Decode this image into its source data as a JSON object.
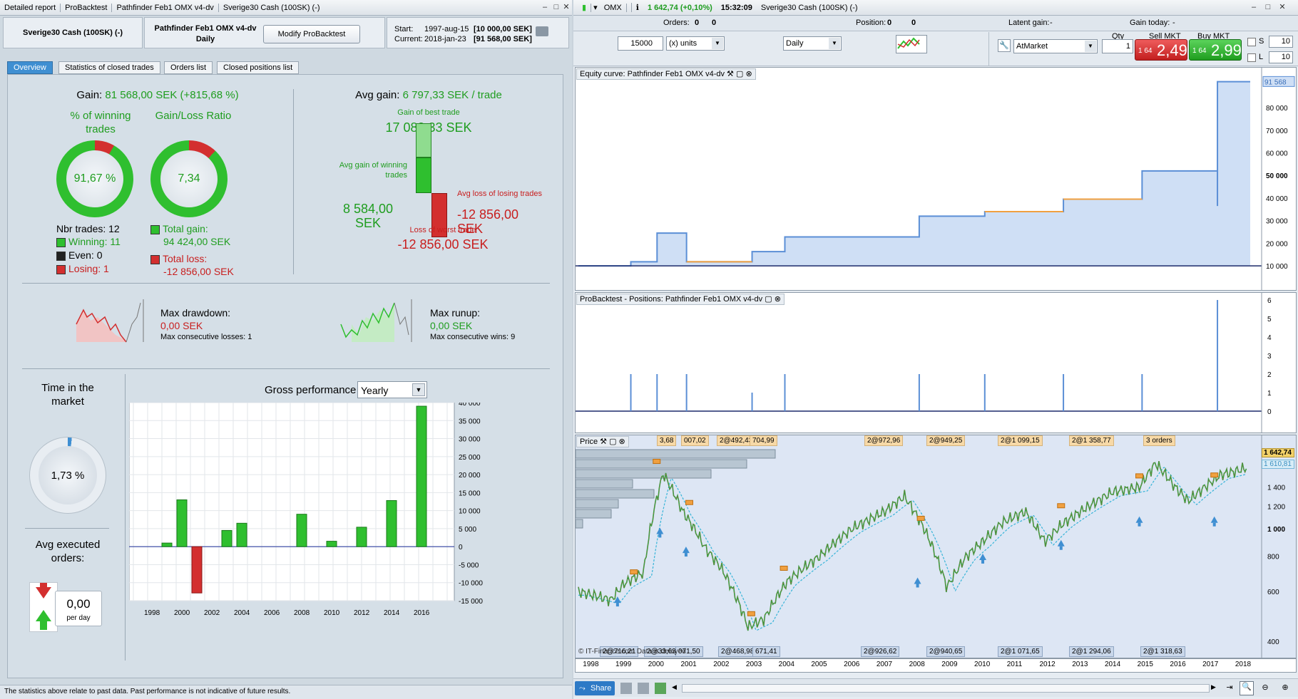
{
  "left_window": {
    "tabs_title": [
      "Detailed report",
      "ProBacktest",
      "Pathfinder Feb1 OMX v4-dv",
      "Sverige30 Cash (100SK) (-)"
    ],
    "instrument": "Sverige30 Cash (100SK) (-)",
    "strategy_name": "Pathfinder Feb1 OMX v4-dv",
    "timeframe": "Daily",
    "modify_button": "Modify ProBacktest",
    "start_label": "Start:",
    "start_value": "1997-aug-15",
    "start_capital": "[10 000,00 SEK]",
    "current_label": "Current:",
    "current_value": "2018-jan-23",
    "current_capital": "[91 568,00 SEK]",
    "tabs": [
      "Overview",
      "Statistics of closed trades",
      "Orders list",
      "Closed positions list"
    ],
    "gain_label": "Gain:",
    "gain_value": "81 568,00 SEK (+815,68 %)",
    "pct_winning_label": "% of winning trades",
    "pct_winning_value": "91,67 %",
    "gain_loss_label": "Gain/Loss Ratio",
    "gain_loss_value": "7,34",
    "nbr_trades": "Nbr trades: 12",
    "winning": "Winning: 11",
    "even": "Even: 0",
    "losing": "Losing: 1",
    "total_gain_label": "Total gain:",
    "total_gain_value": "94 424,00 SEK",
    "total_loss_label": "Total loss:",
    "total_loss_value": "-12 856,00 SEK",
    "avg_gain_label": "Avg gain:",
    "avg_gain_value": "6 797,33 SEK / trade",
    "best_trade_label": "Gain of best trade",
    "best_trade_value": "17 083,33 SEK",
    "avg_win_label": "Avg gain of winning trades",
    "avg_win_value": "8 584,00 SEK",
    "avg_loss_label": "Avg loss of losing trades",
    "avg_loss_value": "-12 856,00 SEK",
    "worst_trade_label": "Loss of worst trade",
    "worst_trade_value": "-12 856,00 SEK",
    "max_drawdown_label": "Max drawdown:",
    "max_drawdown_value": "0,00 SEK",
    "max_consec_losses": "Max consecutive losses: 1",
    "max_runup_label": "Max runup:",
    "max_runup_value": "0,00 SEK",
    "max_consec_wins": "Max consecutive wins: 9",
    "time_in_market_label": "Time in the market",
    "time_in_market_value": "1,73 %",
    "avg_orders_label": "Avg executed orders:",
    "avg_orders_value": "0,00",
    "avg_orders_unit": "per day",
    "gross_perf_label": "Gross performance",
    "gross_perf_select": "Yearly",
    "disclaimer": "The statistics above relate to past data. Past performance is not indicative of future results."
  },
  "chart_data": [
    {
      "type": "bar",
      "title": "Gross performance",
      "categories": [
        "1999",
        "2000",
        "2001",
        "2003",
        "2004",
        "2008",
        "2010",
        "2012",
        "2014",
        "2016"
      ],
      "values": [
        1000,
        13000,
        -12856,
        4500,
        6500,
        9000,
        1500,
        5400,
        12800,
        39000
      ],
      "x_ticks": [
        "1998",
        "2000",
        "2002",
        "2004",
        "2006",
        "2008",
        "2010",
        "2012",
        "2014",
        "2016"
      ],
      "y_ticks": [
        "40 000",
        "35 000",
        "30 000",
        "25 000",
        "20 000",
        "15 000",
        "10 000",
        "5 000",
        "0",
        "-5 000",
        "-10 000",
        "-15 000"
      ],
      "ylim": [
        -15000,
        40000
      ]
    },
    {
      "type": "line",
      "title": "Equity curve: Pathfinder Feb1 OMX v4-dv",
      "y_ticks": [
        "80 000",
        "70 000",
        "60 000",
        "50 000",
        "40 000",
        "30 000",
        "20 000",
        "10 000"
      ],
      "last_value": "91 568",
      "ylim": [
        5000,
        92000
      ]
    },
    {
      "type": "bar",
      "title": "ProBacktest - Positions: Pathfinder Feb1 OMX v4-dv",
      "y_ticks": [
        "6",
        "5",
        "4",
        "3",
        "2",
        "1",
        "0"
      ],
      "ylim": [
        0,
        6
      ]
    }
  ],
  "right_window": {
    "title": "OMX",
    "price": "1 642,74 (+0,10%)",
    "time": "15:32:09",
    "instrument": "Sverige30 Cash (100SK) (-)",
    "orders_label": "Orders:",
    "orders_value": "0",
    "orders_value2": "0",
    "position_label": "Position:",
    "position_value": "0",
    "position_value2": "0",
    "latent_gain_label": "Latent gain:",
    "latent_gain_value": "-",
    "gain_today_label": "Gain today:",
    "gain_today_value": "-",
    "units_value": "15000",
    "units_select": "(x) units",
    "timeframe_select": "Daily",
    "qty_label": "Qty",
    "qty_value": "1",
    "order_type": "AtMarket",
    "sell_label": "Sell MKT",
    "sell_prefix": "1 64",
    "sell_price": "2,49",
    "buy_label": "Buy MKT",
    "buy_prefix": "1 64",
    "buy_price": "2,99",
    "s_value": "10",
    "l_value": "10",
    "price_panel_title": "Price",
    "price_axis": [
      "1 400",
      "1 200",
      "1 000",
      "800",
      "600",
      "400"
    ],
    "price_last": "1 642,74",
    "price_ma": "1 610,81",
    "order_labels_top": [
      "3,68",
      "007,02",
      "2@492,43",
      "704,99",
      "2@972,96",
      "2@949,25",
      "2@1 099,15",
      "2@1 358,77",
      "3 orders"
    ],
    "order_labels_bottom": [
      "2@716,21",
      "2@33,63",
      "071,50",
      "2@468,98",
      "671,41",
      "2@926,62",
      "2@940,65",
      "2@1 071,65",
      "2@1 294,06",
      "2@1 318,63"
    ],
    "watermark": "© IT-Finance.com Data is delayed",
    "years": [
      "1998",
      "1999",
      "2000",
      "2001",
      "2002",
      "2003",
      "2004",
      "2005",
      "2006",
      "2007",
      "2008",
      "2009",
      "2010",
      "2011",
      "2012",
      "2013",
      "2014",
      "2015",
      "2016",
      "2017",
      "2018"
    ],
    "share_button": "Share"
  }
}
